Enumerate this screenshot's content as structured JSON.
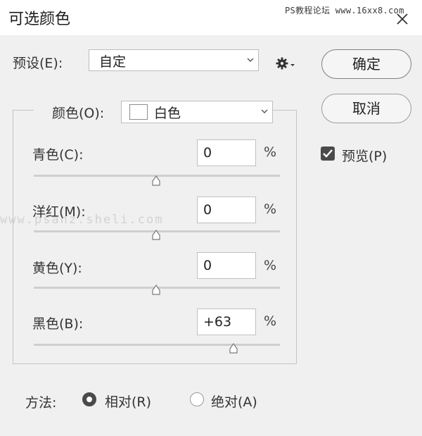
{
  "dialog": {
    "title": "可选颜色",
    "watermark_top": "PS教程论坛 www.16xx8.com",
    "watermark_mid": "www.psahz.sheli.com"
  },
  "preset": {
    "label": "预设(E):",
    "value": "自定",
    "menu_icon": "gear-icon"
  },
  "buttons": {
    "ok": "确定",
    "cancel": "取消"
  },
  "preview": {
    "label": "预览(P)",
    "checked": true
  },
  "colors": {
    "label": "颜色(O):",
    "value": "白色",
    "swatch_color": "#ffffff"
  },
  "sliders": [
    {
      "label": "青色(C):",
      "value": "0",
      "unit": "%",
      "percent": 0
    },
    {
      "label": "洋红(M):",
      "value": "0",
      "unit": "%",
      "percent": 0
    },
    {
      "label": "黄色(Y):",
      "value": "0",
      "unit": "%",
      "percent": 0
    },
    {
      "label": "黑色(B):",
      "value": "+63",
      "unit": "%",
      "percent": 63
    }
  ],
  "method": {
    "label": "方法:",
    "options": [
      {
        "label": "相对(R)",
        "selected": true
      },
      {
        "label": "绝对(A)",
        "selected": false
      }
    ]
  }
}
